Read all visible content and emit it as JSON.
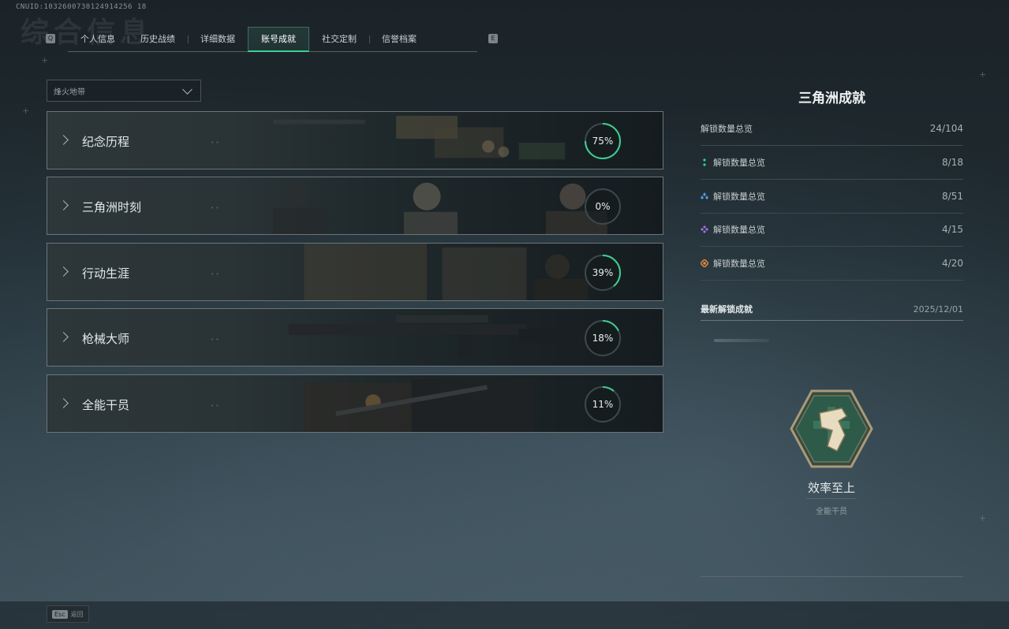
{
  "header": {
    "uid": "CNUID:1032600730124914256 18",
    "ghost_title": "综合信息",
    "tab_key_left": "Q",
    "tab_key_right": "E",
    "tabs": [
      {
        "label": "个人信息"
      },
      {
        "label": "历史战绩"
      },
      {
        "label": "详细数据"
      },
      {
        "label": "账号成就",
        "active": true
      },
      {
        "label": "社交定制"
      },
      {
        "label": "信誉档案"
      }
    ]
  },
  "filter": {
    "selected": "烽火地带"
  },
  "categories": [
    {
      "label": "纪念历程",
      "progress": 75,
      "progress_text": "75%"
    },
    {
      "label": "三角洲时刻",
      "progress": 0,
      "progress_text": "0%"
    },
    {
      "label": "行动生涯",
      "progress": 39,
      "progress_text": "39%"
    },
    {
      "label": "枪械大师",
      "progress": 18,
      "progress_text": "18%"
    },
    {
      "label": "全能干员",
      "progress": 11,
      "progress_text": "11%"
    }
  ],
  "summary": {
    "title": "三角洲成就",
    "rows": [
      {
        "label": "解锁数量总览",
        "value": "24/104",
        "icon": "none"
      },
      {
        "label": "解锁数量总览",
        "value": "8/18",
        "icon": "green-gem-icon",
        "color": "#2fd6a0"
      },
      {
        "label": "解锁数量总览",
        "value": "8/51",
        "icon": "blue-gem-icon",
        "color": "#4a9ee8"
      },
      {
        "label": "解锁数量总览",
        "value": "4/15",
        "icon": "purple-gem-icon",
        "color": "#a070e0"
      },
      {
        "label": "解锁数量总览",
        "value": "4/20",
        "icon": "orange-gem-icon",
        "color": "#e88a3a"
      }
    ],
    "latest_label": "最新解锁成就",
    "latest_date": "2025/12/01",
    "achievement": {
      "name": "效率至上",
      "category": "全能干员"
    }
  },
  "footer": {
    "esc_key": "Esc",
    "esc_label": "返回"
  },
  "colors": {
    "accent": "#3cd08f",
    "ring_track": "#3e484c"
  }
}
